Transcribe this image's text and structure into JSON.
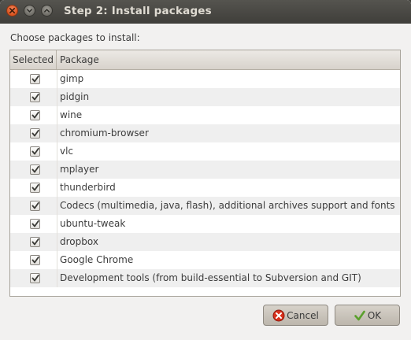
{
  "window": {
    "title": "Step 2: Install packages"
  },
  "prompt": "Choose packages to install:",
  "table": {
    "columns": [
      "Selected",
      "Package"
    ],
    "rows": [
      {
        "selected": true,
        "package": "gimp"
      },
      {
        "selected": true,
        "package": "pidgin"
      },
      {
        "selected": true,
        "package": "wine"
      },
      {
        "selected": true,
        "package": "chromium-browser"
      },
      {
        "selected": true,
        "package": "vlc"
      },
      {
        "selected": true,
        "package": "mplayer"
      },
      {
        "selected": true,
        "package": "thunderbird"
      },
      {
        "selected": true,
        "package": "Codecs (multimedia, java, flash), additional archives support and fonts"
      },
      {
        "selected": true,
        "package": "ubuntu-tweak"
      },
      {
        "selected": true,
        "package": "dropbox"
      },
      {
        "selected": true,
        "package": "Google Chrome"
      },
      {
        "selected": true,
        "package": "Development tools (from build-essential to Subversion and GIT)"
      }
    ]
  },
  "buttons": {
    "cancel": "Cancel",
    "ok": "OK"
  },
  "colors": {
    "titlebar": "#3f3e3a",
    "close_button": "#df5a24",
    "dialog_bg": "#f2f1f0",
    "row_alt": "#efefef"
  }
}
